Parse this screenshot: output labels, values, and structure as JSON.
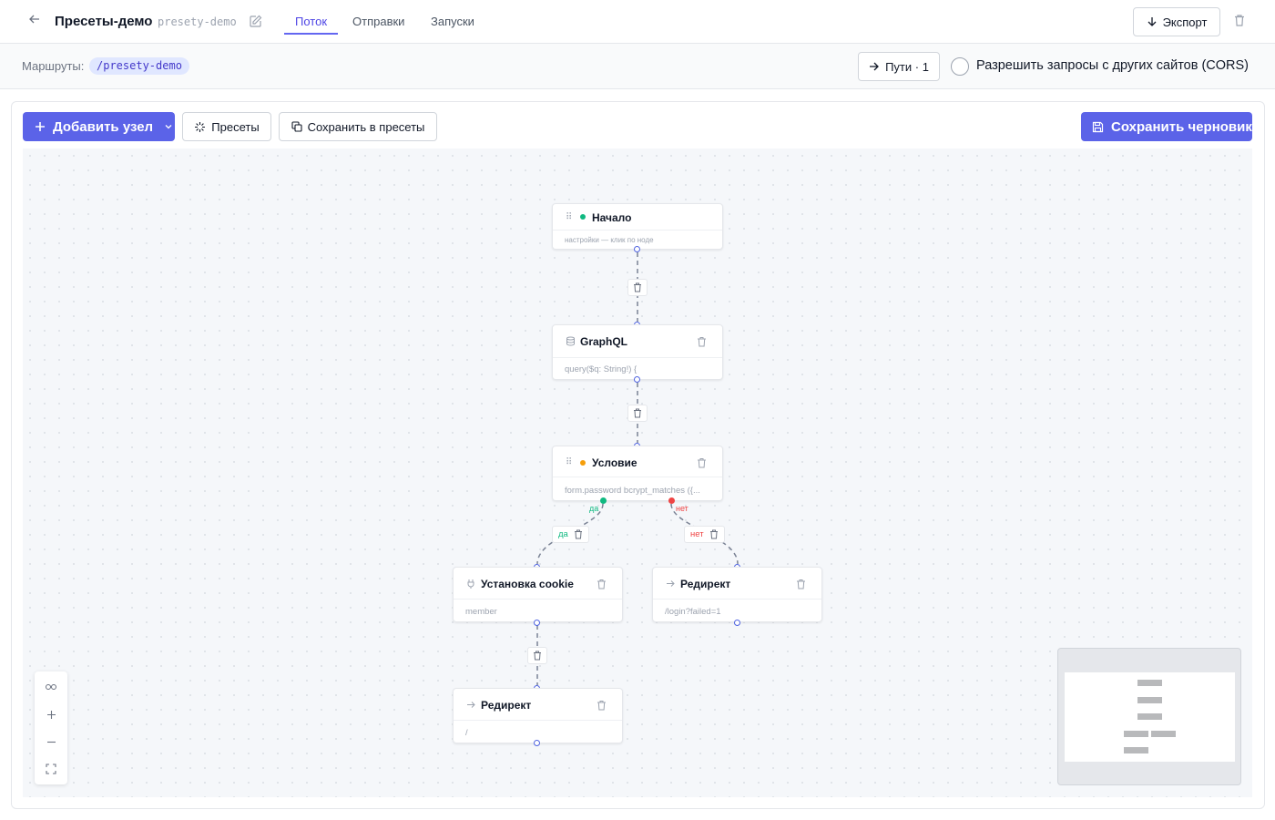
{
  "header": {
    "title": "Пресеты-демо",
    "slug": "presety-demo",
    "tabs": [
      {
        "label": "Поток",
        "active": true
      },
      {
        "label": "Отправки",
        "active": false
      },
      {
        "label": "Запуски",
        "active": false
      }
    ],
    "export_label": "Экспорт"
  },
  "routes": {
    "label": "Маршруты:",
    "route": "/presety-demo",
    "paths_label": "Пути · 1",
    "cors_label": "Разрешить запросы с других сайтов (CORS)",
    "cors_checked": false
  },
  "toolbar": {
    "add_node_label": "Добавить узел",
    "presets_label": "Пресеты",
    "save_to_presets_label": "Сохранить в пресеты",
    "save_draft_label": "Сохранить черновик"
  },
  "nodes": {
    "start": {
      "title": "Начало",
      "subtitle": "настройки — клик по ноде",
      "status_color": "#10b981"
    },
    "graphql": {
      "title": "GraphQL",
      "subtitle": "query($q: String!) {"
    },
    "condition": {
      "title": "Условие",
      "subtitle": "form.password bcrypt_matches ({...",
      "status_color": "#f59e0b"
    },
    "set_cookie": {
      "title": "Установка cookie",
      "subtitle": "member"
    },
    "redirect_fail": {
      "title": "Редирект",
      "subtitle": "/login?failed=1"
    },
    "redirect_home": {
      "title": "Редирект",
      "subtitle": "/"
    }
  },
  "edges": {
    "yes_label": "да",
    "no_label": "нет",
    "yes_color": "#10b981",
    "no_color": "#ef4444"
  },
  "colors": {
    "accent": "#5b63e8",
    "handle": "#4f63e0"
  }
}
